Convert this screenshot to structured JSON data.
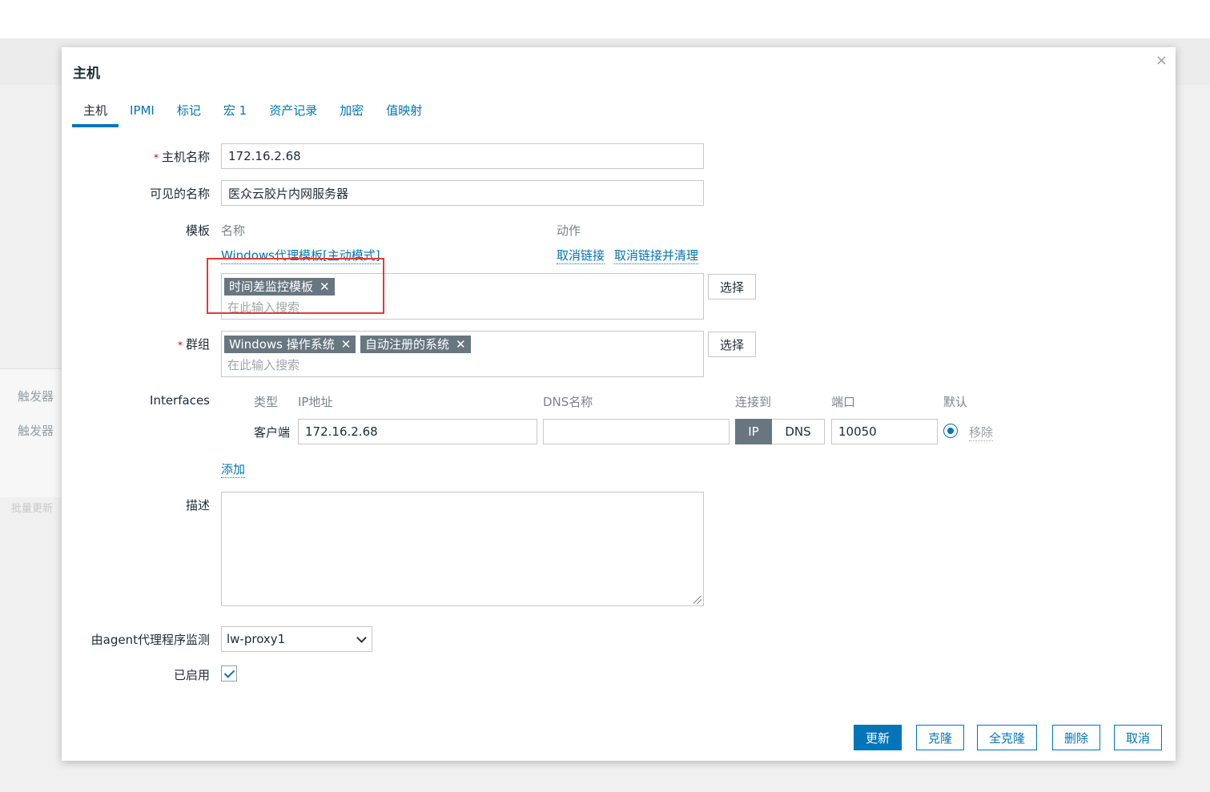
{
  "background": {
    "side_items": [
      "触发器",
      "触发器"
    ],
    "side_faint": "批量更新"
  },
  "modal": {
    "title": "主机",
    "close_symbol": "×"
  },
  "tabs": [
    {
      "label": "主机",
      "active": true
    },
    {
      "label": "IPMI"
    },
    {
      "label": "标记"
    },
    {
      "label": "宏 1"
    },
    {
      "label": "资产记录"
    },
    {
      "label": "加密"
    },
    {
      "label": "值映射"
    }
  ],
  "host": {
    "hostname_label": "主机名称",
    "hostname_value": "172.16.2.68",
    "visible_label": "可见的名称",
    "visible_value": "医众云胶片内网服务器"
  },
  "templates": {
    "label": "模板",
    "col_name": "名称",
    "col_action": "动作",
    "linked_name": "Windows代理模板[主动模式]",
    "unlink": "取消链接",
    "unlink_clear": "取消链接并清理",
    "chip": "时间差监控模板",
    "chip_x": "✕",
    "search_placeholder": "在此输入搜索",
    "select_button": "选择"
  },
  "groups": {
    "label": "群组",
    "chips": [
      "Windows 操作系统",
      "自动注册的系统"
    ],
    "chip_x": "✕",
    "search_placeholder": "在此输入搜索",
    "select_button": "选择"
  },
  "interfaces": {
    "label": "Interfaces",
    "col_type": "类型",
    "col_ip": "IP地址",
    "col_dns": "DNS名称",
    "col_connect": "连接到",
    "col_port": "端口",
    "col_default": "默认",
    "row_type": "客户端",
    "ip_value": "172.16.2.68",
    "dns_value": "",
    "connect_ip": "IP",
    "connect_dns": "DNS",
    "port_value": "10050",
    "remove": "移除",
    "add": "添加"
  },
  "description": {
    "label": "描述",
    "value": ""
  },
  "proxy": {
    "label": "由agent代理程序监测",
    "value": "lw-proxy1"
  },
  "enabled": {
    "label": "已启用",
    "checked": true
  },
  "footer": {
    "update": "更新",
    "clone": "克隆",
    "full_clone": "全克隆",
    "delete": "删除",
    "cancel": "取消"
  },
  "colors": {
    "accent": "#0275b8",
    "chip_bg": "#687680",
    "required": "#d40000",
    "highlight": "#e53935"
  }
}
